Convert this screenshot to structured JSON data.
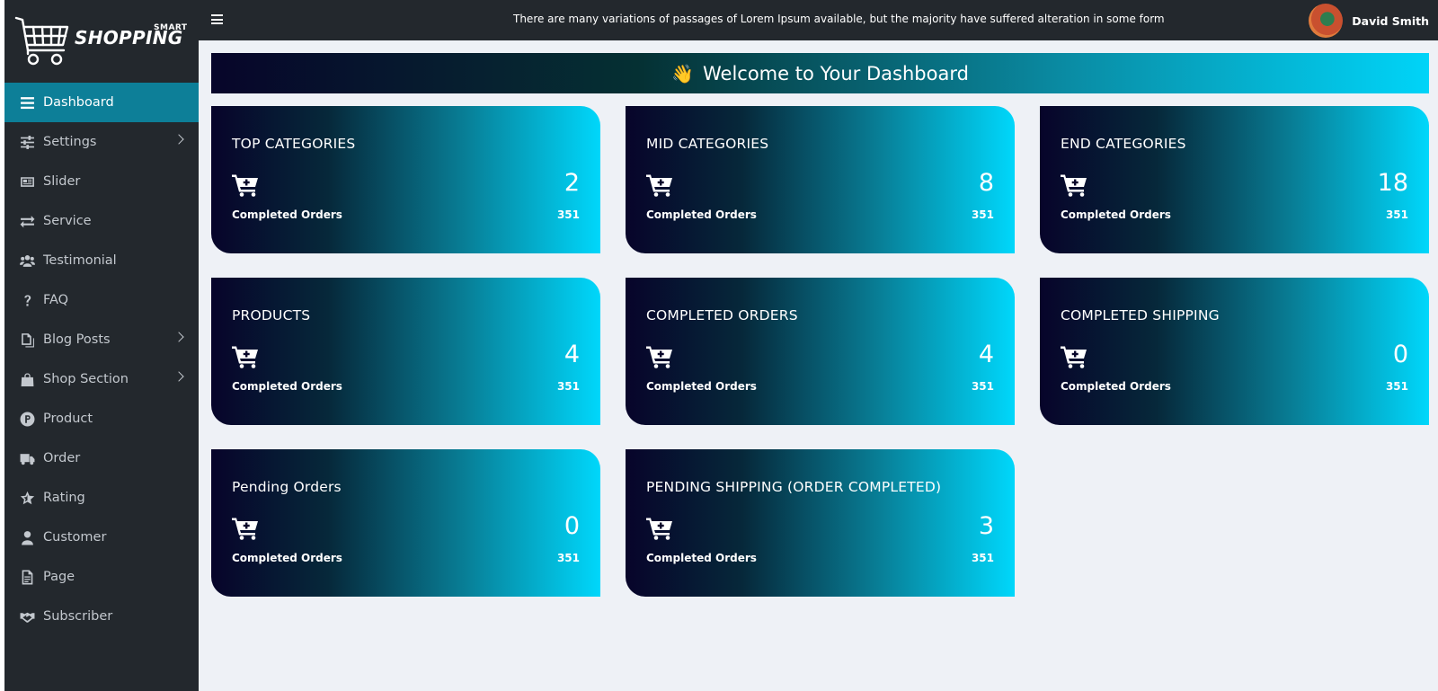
{
  "brand": {
    "name": "SHOPPING",
    "tag": "SMART"
  },
  "sidebar": {
    "items": [
      {
        "label": "Dashboard",
        "icon": "bars-icon",
        "active": true,
        "has_submenu": false
      },
      {
        "label": "Settings",
        "icon": "sliders-icon",
        "active": false,
        "has_submenu": true
      },
      {
        "label": "Slider",
        "icon": "newspaper-icon",
        "active": false,
        "has_submenu": false
      },
      {
        "label": "Service",
        "icon": "exchange-icon",
        "active": false,
        "has_submenu": false
      },
      {
        "label": "Testimonial",
        "icon": "users-icon",
        "active": false,
        "has_submenu": false
      },
      {
        "label": "FAQ",
        "icon": "question-icon",
        "active": false,
        "has_submenu": false
      },
      {
        "label": "Blog Posts",
        "icon": "copy-icon",
        "active": false,
        "has_submenu": true
      },
      {
        "label": "Shop Section",
        "icon": "shopping-bag-icon",
        "active": false,
        "has_submenu": true
      },
      {
        "label": "Product",
        "icon": "product-p-icon",
        "active": false,
        "has_submenu": false
      },
      {
        "label": "Order",
        "icon": "truck-icon",
        "active": false,
        "has_submenu": false
      },
      {
        "label": "Rating",
        "icon": "star-icon",
        "active": false,
        "has_submenu": false
      },
      {
        "label": "Customer",
        "icon": "user-icon",
        "active": false,
        "has_submenu": false
      },
      {
        "label": "Page",
        "icon": "file-icon",
        "active": false,
        "has_submenu": false
      },
      {
        "label": "Subscriber",
        "icon": "handshake-icon",
        "active": false,
        "has_submenu": false
      }
    ]
  },
  "header": {
    "marquee": "There are many variations of passages of Lorem Ipsum available, but the majority have suffered alteration in some form",
    "user_name": "David Smith"
  },
  "banner": {
    "emoji": "👋",
    "title": "Welcome to Your Dashboard"
  },
  "cards": [
    {
      "title": "TOP CATEGORIES",
      "value": "2",
      "label": "Completed Orders",
      "count": "351"
    },
    {
      "title": "MID CATEGORIES",
      "value": "8",
      "label": "Completed Orders",
      "count": "351"
    },
    {
      "title": "END CATEGORIES",
      "value": "18",
      "label": "Completed Orders",
      "count": "351"
    },
    {
      "title": "PRODUCTS",
      "value": "4",
      "label": "Completed Orders",
      "count": "351"
    },
    {
      "title": "COMPLETED ORDERS",
      "value": "4",
      "label": "Completed Orders",
      "count": "351"
    },
    {
      "title": "COMPLETED SHIPPING",
      "value": "0",
      "label": "Completed Orders",
      "count": "351"
    },
    {
      "title": "Pending Orders",
      "value": "0",
      "label": "Completed Orders",
      "count": "351"
    },
    {
      "title": "PENDING SHIPPING (ORDER COMPLETED)",
      "value": "3",
      "label": "Completed Orders",
      "count": "351"
    }
  ],
  "colors": {
    "sidebar_bg": "#23282d",
    "active_item": "#0d7f98",
    "accent": "#00d4f8",
    "page_bg": "#eef1f6"
  }
}
